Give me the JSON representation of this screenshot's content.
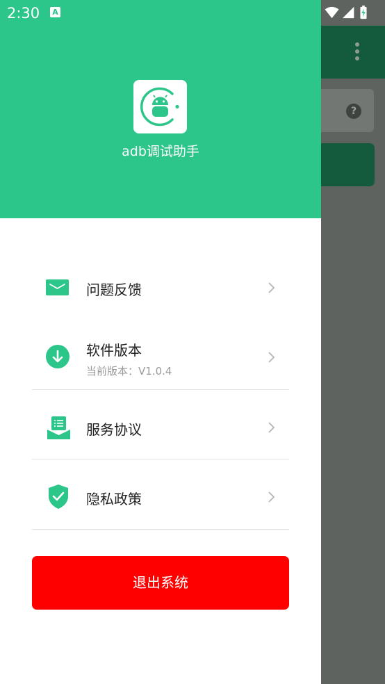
{
  "status_bar": {
    "time": "2:30",
    "notif_glyph": "A"
  },
  "background": {
    "help_glyph": "?"
  },
  "drawer": {
    "app_name": "adb调试助手",
    "menu": [
      {
        "label": "问题反馈",
        "icon": "mail-icon"
      },
      {
        "label": "软件版本",
        "sublabel": "当前版本：V1.0.4",
        "icon": "download-icon"
      },
      {
        "label": "服务协议",
        "icon": "document-icon"
      },
      {
        "label": "隐私政策",
        "icon": "shield-check-icon"
      }
    ],
    "logout_label": "退出系统"
  },
  "colors": {
    "primary": "#2cc68a",
    "danger": "#ff0000",
    "toolbar": "#145a3c"
  }
}
